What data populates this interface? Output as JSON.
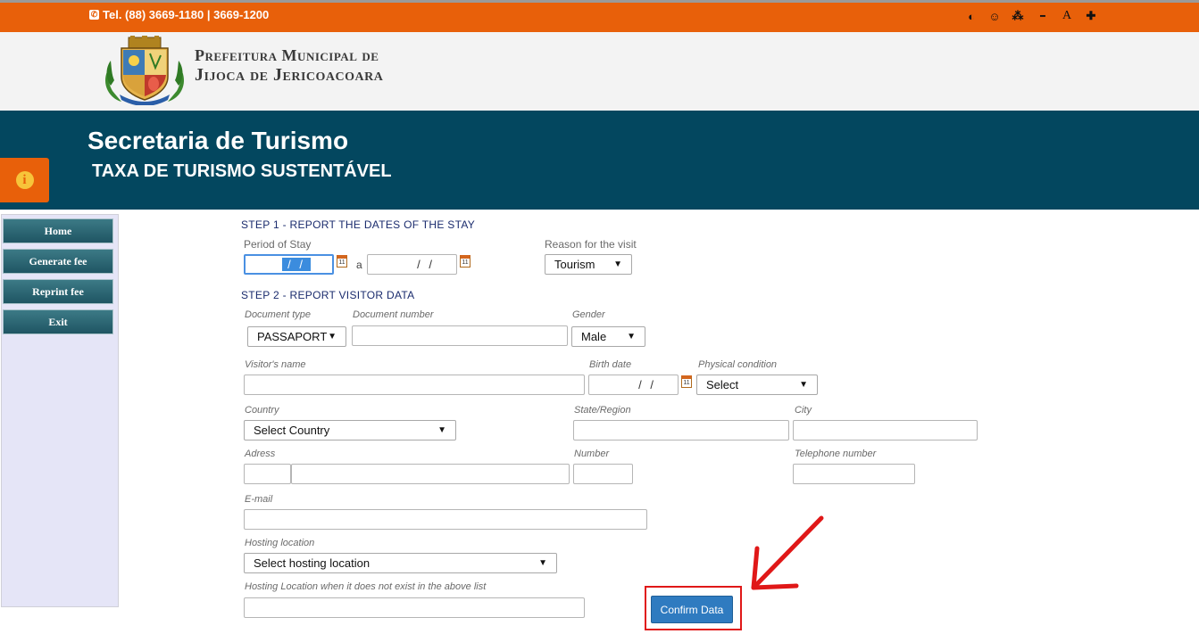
{
  "topbar": {
    "phone": "Tel. (88) 3669-1180 | 3669-1200",
    "accessibility": [
      {
        "name": "contrast-icon",
        "glyph": "◐"
      },
      {
        "name": "smiley-icon",
        "glyph": "☺"
      },
      {
        "name": "sitemap-icon",
        "glyph": "⁂"
      },
      {
        "name": "decrease-font-icon",
        "glyph": "━"
      },
      {
        "name": "font-icon",
        "glyph": "A"
      },
      {
        "name": "increase-font-icon",
        "glyph": "✚"
      }
    ]
  },
  "header": {
    "brand_line1": "Prefeitura Municipal de",
    "brand_line2": "Jijoca de Jericoacoara"
  },
  "banner": {
    "title": "Secretaria de Turismo",
    "subtitle": "TAXA DE TURISMO SUSTENTÁVEL",
    "info_glyph": "i"
  },
  "sidebar": {
    "items": [
      {
        "label": "Home"
      },
      {
        "label": "Generate fee"
      },
      {
        "label": "Reprint fee"
      },
      {
        "label": "Exit"
      }
    ]
  },
  "step1": {
    "heading": "STEP 1 - REPORT THE DATES OF THE STAY",
    "period_label": "Period of Stay",
    "date_from": "/ /",
    "date_separator": "a",
    "date_to": "/ /",
    "reason_label": "Reason for the visit",
    "reason_value": "Tourism"
  },
  "step2": {
    "heading": "STEP 2 - REPORT VISITOR DATA",
    "doc_type_label": "Document type",
    "doc_type_value": "PASSAPORT",
    "doc_number_label": "Document number",
    "gender_label": "Gender",
    "gender_value": "Male",
    "name_label": "Visitor's name",
    "birth_label": "Birth date",
    "birth_value": "/ /",
    "physical_label": "Physical condition",
    "physical_value": "Select",
    "country_label": "Country",
    "country_value": "Select Country",
    "state_label": "State/Region",
    "city_label": "City",
    "address_label": "Adress",
    "number_label": "Number",
    "phone_label": "Telephone number",
    "email_label": "E-mail",
    "hosting_label": "Hosting location",
    "hosting_value": "Select hosting location",
    "hosting_other_label": "Hosting Location when it does not exist in the above list"
  },
  "confirm": {
    "label": "Confirm Data"
  },
  "colors": {
    "topbar": "#e8600a",
    "banner": "#03475f",
    "sidebar_bg": "#e5e5f7",
    "button": "#2f7bc0",
    "annotation": "#e01818"
  }
}
